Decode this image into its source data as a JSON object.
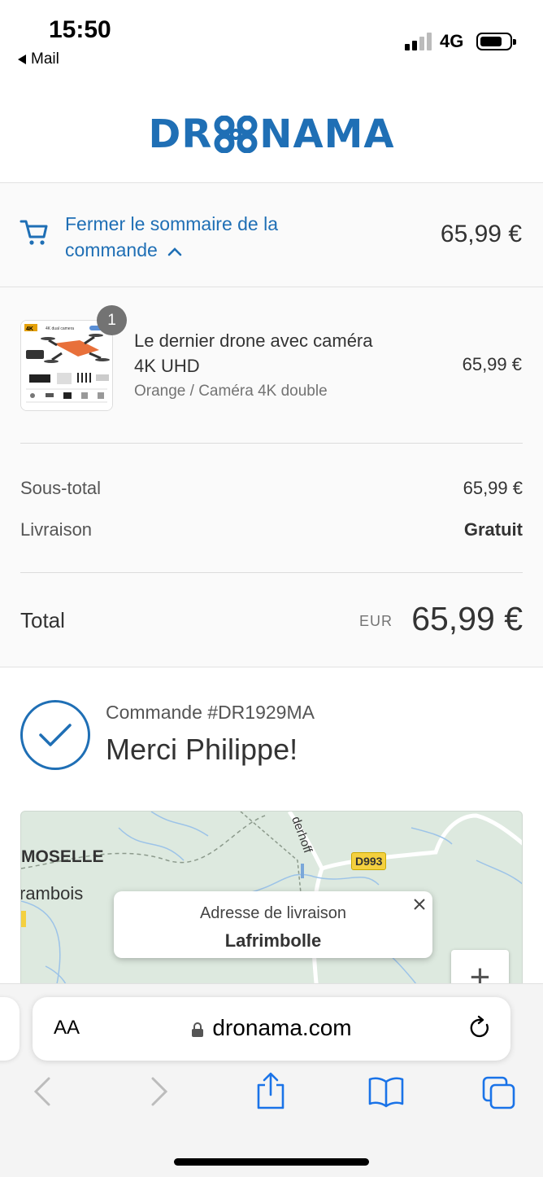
{
  "status": {
    "time": "15:50",
    "back_app": "Mail",
    "network": "4G"
  },
  "brand": {
    "name_left": "DR",
    "name_right": "NAMA",
    "color": "#1f6fb5"
  },
  "summary_toggle": {
    "label": "Fermer le sommaire de la commande",
    "total": "65,99 €"
  },
  "product": {
    "quantity": "1",
    "title": "Le dernier drone avec caméra 4K UHD",
    "variant": "Orange / Caméra 4K double",
    "price": "65,99 €",
    "image_badge": "4K",
    "image_caption": "4K dual camera"
  },
  "costs": {
    "subtotal_label": "Sous-total",
    "subtotal_value": "65,99 €",
    "shipping_label": "Livraison",
    "shipping_value": "Gratuit",
    "total_label": "Total",
    "total_currency": "EUR",
    "total_value": "65,99 €"
  },
  "confirmation": {
    "order_number": "Commande #DR1929MA",
    "thanks": "Merci Philippe!"
  },
  "map": {
    "labels": [
      "MOSELLE",
      "rambois",
      "derhoff"
    ],
    "road": "D993",
    "popup_title": "Adresse de livraison",
    "popup_city": "Lafrimbolle",
    "zoom_in": "+"
  },
  "browser": {
    "text_size": "AA",
    "url": "dronama.com"
  }
}
